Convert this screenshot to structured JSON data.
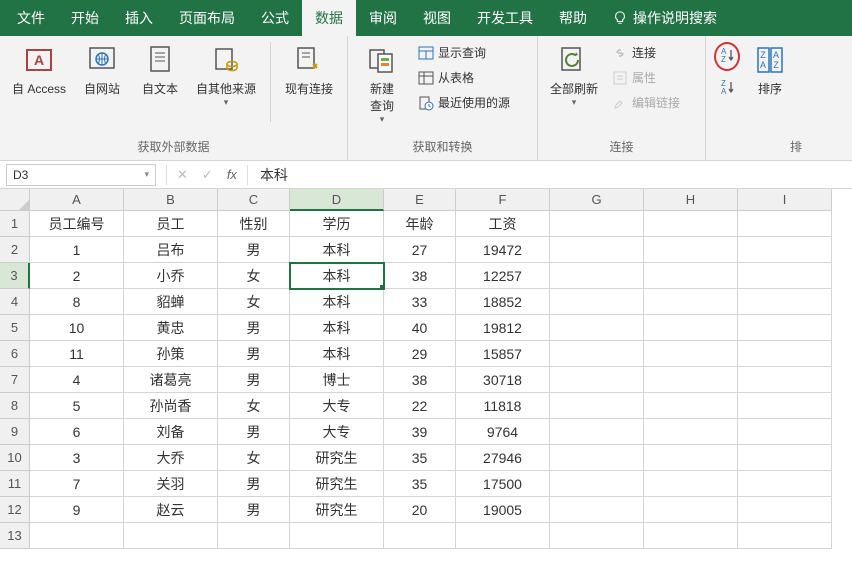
{
  "tabs": [
    "文件",
    "开始",
    "插入",
    "页面布局",
    "公式",
    "数据",
    "审阅",
    "视图",
    "开发工具",
    "帮助"
  ],
  "active_tab": 5,
  "help_search": "操作说明搜索",
  "ribbon": {
    "g1": {
      "label": "获取外部数据",
      "btns": [
        "自 Access",
        "自网站",
        "自文本",
        "自其他来源",
        "现有连接"
      ]
    },
    "g2": {
      "label": "获取和转换",
      "btn": "新建\n查询",
      "items": [
        "显示查询",
        "从表格",
        "最近使用的源"
      ]
    },
    "g3": {
      "label": "连接",
      "btn": "全部刷新",
      "items": [
        "连接",
        "属性",
        "编辑链接"
      ]
    },
    "g4": {
      "label": "排",
      "btn": "排序"
    }
  },
  "namebox": "D3",
  "formula": "本科",
  "cols": [
    "A",
    "B",
    "C",
    "D",
    "E",
    "F",
    "G",
    "H",
    "I"
  ],
  "active_cell": {
    "row": 3,
    "col": 3
  },
  "data": [
    [
      "员工编号",
      "员工",
      "性别",
      "学历",
      "年龄",
      "工资"
    ],
    [
      "1",
      "吕布",
      "男",
      "本科",
      "27",
      "19472"
    ],
    [
      "2",
      "小乔",
      "女",
      "本科",
      "38",
      "12257"
    ],
    [
      "8",
      "貂蝉",
      "女",
      "本科",
      "33",
      "18852"
    ],
    [
      "10",
      "黄忠",
      "男",
      "本科",
      "40",
      "19812"
    ],
    [
      "11",
      "孙策",
      "男",
      "本科",
      "29",
      "15857"
    ],
    [
      "4",
      "诸葛亮",
      "男",
      "博士",
      "38",
      "30718"
    ],
    [
      "5",
      "孙尚香",
      "女",
      "大专",
      "22",
      "11818"
    ],
    [
      "6",
      "刘备",
      "男",
      "大专",
      "39",
      "9764"
    ],
    [
      "3",
      "大乔",
      "女",
      "研究生",
      "35",
      "27946"
    ],
    [
      "7",
      "关羽",
      "男",
      "研究生",
      "35",
      "17500"
    ],
    [
      "9",
      "赵云",
      "男",
      "研究生",
      "20",
      "19005"
    ]
  ],
  "total_rows": 13
}
